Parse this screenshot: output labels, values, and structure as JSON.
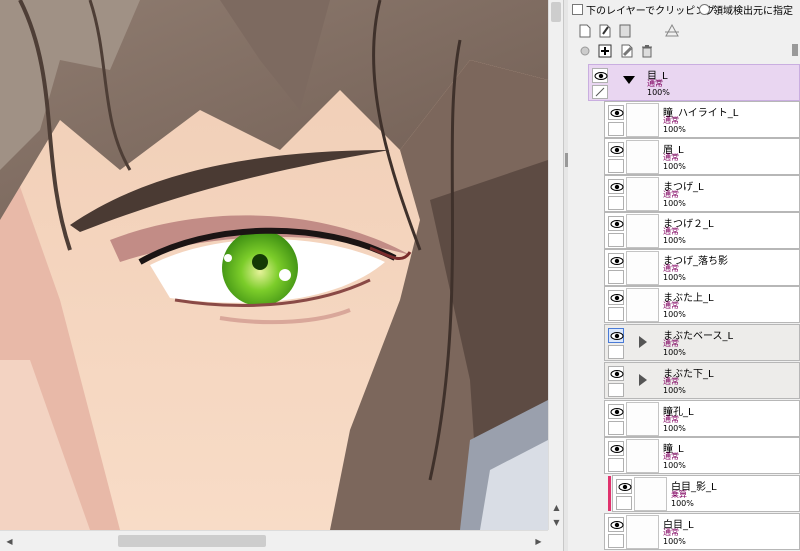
{
  "options": {
    "clipping_label": "下のレイヤーでクリッピング",
    "selection_source_label": "領域検出元に指定"
  },
  "toolbar": {
    "icons": [
      "new-layer-icon",
      "new-pen-layer-icon",
      "new-folder-icon",
      "layer-properties-icon",
      "transfer-down-icon",
      "merge-down-icon",
      "clear-layer-icon",
      "delete-layer-icon"
    ]
  },
  "layers": [
    {
      "name": "目_L",
      "mode": "通常",
      "opacity": "100%",
      "kind": "folder-open"
    },
    {
      "name": "瞳_ハイライト_L",
      "mode": "通常",
      "opacity": "100%",
      "kind": "layer"
    },
    {
      "name": "眉_L",
      "mode": "通常",
      "opacity": "100%",
      "kind": "layer"
    },
    {
      "name": "まつげ_L",
      "mode": "通常",
      "opacity": "100%",
      "kind": "layer"
    },
    {
      "name": "まつげ２_L",
      "mode": "通常",
      "opacity": "100%",
      "kind": "layer"
    },
    {
      "name": "まつげ_落ち影",
      "mode": "通常",
      "opacity": "100%",
      "kind": "layer"
    },
    {
      "name": "まぶた上_L",
      "mode": "通常",
      "opacity": "100%",
      "kind": "layer"
    },
    {
      "name": "まぶたベース_L",
      "mode": "通常",
      "opacity": "100%",
      "kind": "folder"
    },
    {
      "name": "まぶた下_L",
      "mode": "通常",
      "opacity": "100%",
      "kind": "folder"
    },
    {
      "name": "瞳孔_L",
      "mode": "通常",
      "opacity": "100%",
      "kind": "layer"
    },
    {
      "name": "瞳_L",
      "mode": "通常",
      "opacity": "100%",
      "kind": "layer"
    },
    {
      "name": "白目_影_L",
      "mode": "乗算",
      "opacity": "100%",
      "kind": "layer-clip"
    },
    {
      "name": "白目_L",
      "mode": "通常",
      "opacity": "100%",
      "kind": "layer"
    }
  ],
  "colors": {
    "folder_open": "#e9d6f1",
    "clipping_bar": "#e0326d",
    "mode_text": "#800060",
    "iris": "#5fbf1e"
  }
}
